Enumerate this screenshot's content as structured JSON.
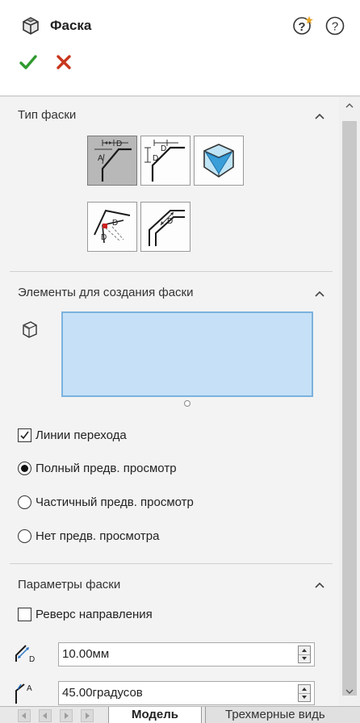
{
  "header": {
    "title": "Фаска",
    "icons": {
      "title": "chamfer-icon",
      "help_a": "help-wizard-icon",
      "help_b": "help-icon",
      "ok": "check-icon",
      "cancel": "close-icon"
    },
    "colors": {
      "ok": "#2e9a2e",
      "cancel": "#c8361d"
    }
  },
  "chamfer_type": {
    "title": "Тип фаски",
    "options": [
      {
        "icon": "angle-distance-icon",
        "selected": true
      },
      {
        "icon": "distance-distance-icon",
        "selected": false
      },
      {
        "icon": "vertex-icon",
        "selected": false
      },
      {
        "icon": "offset-face-icon",
        "selected": false
      },
      {
        "icon": "face-face-icon",
        "selected": false
      }
    ]
  },
  "items": {
    "title": "Элементы для создания фаски",
    "selection_icon": "edge-selection-icon",
    "selection_box_color": "#c6e1f7",
    "options": {
      "tangent": {
        "label": "Линии перехода",
        "checked": true
      },
      "preview_full": {
        "label": "Полный предв. просмотр",
        "selected": true
      },
      "preview_partial": {
        "label": "Частичный предв. просмотр",
        "selected": false
      },
      "preview_none": {
        "label": "Нет предв. просмотра",
        "selected": false
      }
    }
  },
  "params": {
    "title": "Параметры фаски",
    "reverse": {
      "label": "Реверс направления",
      "checked": false
    },
    "distance": {
      "value": "10.00мм",
      "icon": "distance-param-icon"
    },
    "angle": {
      "value": "45.00градусов",
      "icon": "angle-param-icon"
    }
  },
  "tabs": {
    "active": "Модель",
    "other": "Трехмерные видь"
  },
  "watermark_color": "#bfeef0"
}
